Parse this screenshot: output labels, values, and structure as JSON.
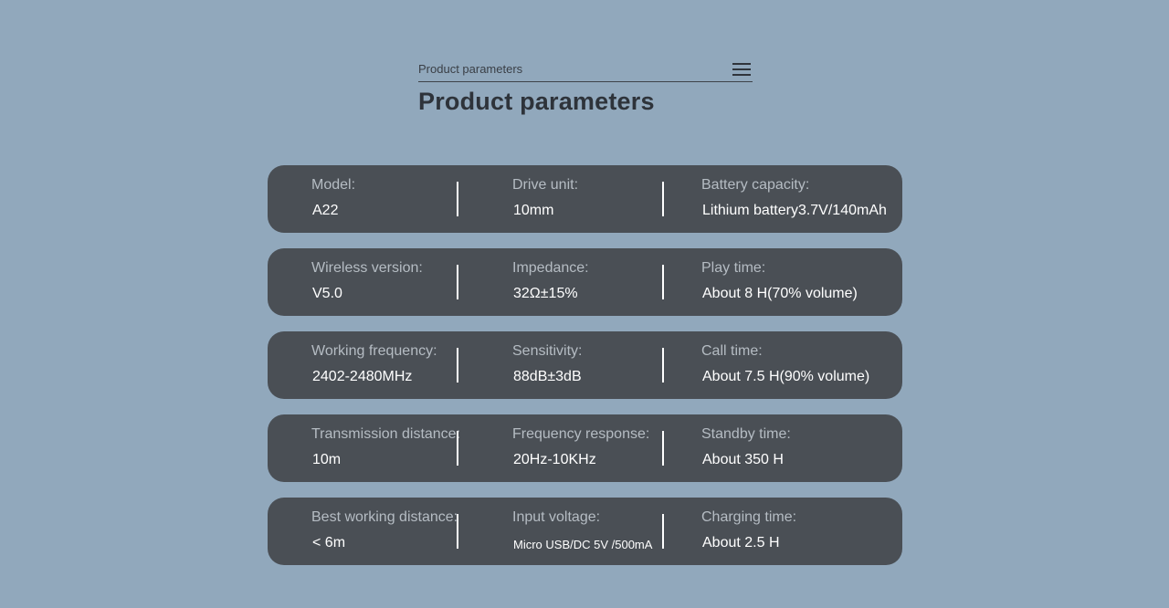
{
  "header": {
    "breadcrumb": "Product parameters",
    "title": "Product parameters",
    "menu_icon": "hamburger-menu-icon"
  },
  "rows": [
    {
      "c1": {
        "label": "Model:",
        "value": "A22"
      },
      "c2": {
        "label": "Drive unit:",
        "value": "10mm"
      },
      "c3": {
        "label": "Battery capacity:",
        "value": "Lithium battery3.7V/140mAh"
      }
    },
    {
      "c1": {
        "label": "Wireless version:",
        "value": "V5.0"
      },
      "c2": {
        "label": "Impedance:",
        "value": "32Ω±15%"
      },
      "c3": {
        "label": "Play time:",
        "value": "About 8 H(70% volume)"
      }
    },
    {
      "c1": {
        "label": "Working frequency:",
        "value": "2402-2480MHz"
      },
      "c2": {
        "label": "Sensitivity:",
        "value": "88dB±3dB"
      },
      "c3": {
        "label": "Call time:",
        "value": "About 7.5 H(90% volume)"
      }
    },
    {
      "c1": {
        "label": "Transmission distance:",
        "value": "10m"
      },
      "c2": {
        "label": "Frequency response:",
        "value": "20Hz-10KHz"
      },
      "c3": {
        "label": "Standby time:",
        "value": "About 350 H"
      }
    },
    {
      "c1": {
        "label": "Best working distance:",
        "value": "< 6m"
      },
      "c2": {
        "label": "Input voltage:",
        "value": "Micro USB/DC 5V /500mA"
      },
      "c3": {
        "label": "Charging time:",
        "value": "About 2.5 H"
      }
    }
  ],
  "colors": {
    "background": "#91a8bc",
    "card": "#4a4f55",
    "label": "#b5bcc3",
    "value": "#ffffff",
    "title": "#2e333a"
  }
}
